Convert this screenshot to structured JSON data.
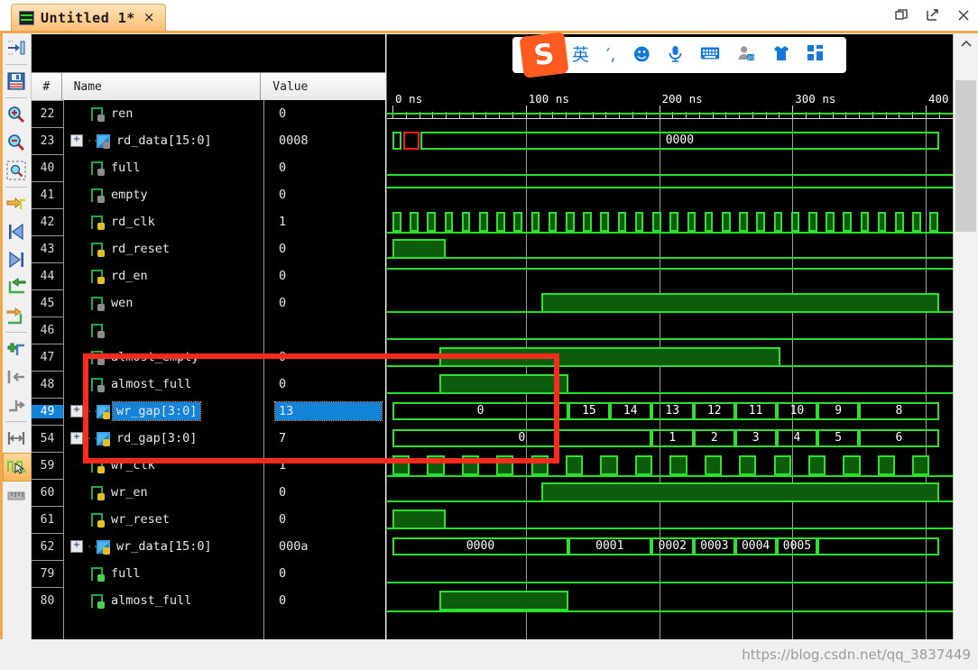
{
  "window": {
    "tab_title": "Untitled 1*",
    "tab_close_label": "×",
    "tab_icon": "waveform-icon",
    "controls": [
      {
        "name": "restore-window-button",
        "label": "❐"
      },
      {
        "name": "float-window-button",
        "label": "↗"
      },
      {
        "name": "close-window-button",
        "label": "✕"
      }
    ]
  },
  "toolbar": {
    "items": [
      {
        "name": "go-to-time-button",
        "icon": "arrow-into-bar-icon"
      },
      {
        "name": "save-waveform-button",
        "icon": "floppy-disk-icon"
      },
      {
        "name": "zoom-in-button",
        "icon": "magnifier-plus-icon"
      },
      {
        "name": "zoom-out-button",
        "icon": "magnifier-minus-icon"
      },
      {
        "name": "zoom-fit-button",
        "icon": "magnifier-fit-icon"
      },
      {
        "name": "snap-to-transition-button",
        "icon": "yellow-arrow-edge-icon"
      },
      {
        "name": "goto-start-button",
        "icon": "skip-to-start-icon"
      },
      {
        "name": "goto-end-button",
        "icon": "skip-to-end-icon"
      },
      {
        "name": "previous-transition-button",
        "icon": "green-arrow-left-icon"
      },
      {
        "name": "next-transition-button",
        "icon": "yellow-arrow-right-icon"
      },
      {
        "name": "add-marker-button",
        "icon": "add-marker-plus-icon"
      },
      {
        "name": "previous-marker-button",
        "icon": "marker-left-icon"
      },
      {
        "name": "next-marker-button",
        "icon": "marker-right-icon"
      },
      {
        "name": "measure-distance-button",
        "icon": "measure-span-icon"
      },
      {
        "name": "snap-to-edge-toggle",
        "icon": "snap-cursor-icon",
        "active": true
      },
      {
        "name": "show-ruler-button",
        "icon": "ruler-icon"
      }
    ]
  },
  "list": {
    "headers": {
      "num": "#",
      "name": "Name",
      "value": "Value"
    },
    "rows": [
      {
        "num": "22",
        "name": "ren",
        "value": "0",
        "icon": "signal-icon",
        "expandable": false,
        "selected": false
      },
      {
        "num": "23",
        "name": "rd_data[15:0]",
        "value": "0008",
        "icon": "bus-signal-icon",
        "expandable": true,
        "selected": false
      },
      {
        "num": "40",
        "name": "full",
        "value": "0",
        "icon": "signal-icon",
        "expandable": false,
        "selected": false
      },
      {
        "num": "41",
        "name": "empty",
        "value": "0",
        "icon": "signal-icon",
        "expandable": false,
        "selected": false
      },
      {
        "num": "42",
        "name": "rd_clk",
        "value": "1",
        "icon": "signal-lock-icon",
        "expandable": false,
        "selected": false
      },
      {
        "num": "43",
        "name": "rd_reset",
        "value": "0",
        "icon": "signal-lock-icon",
        "expandable": false,
        "selected": false
      },
      {
        "num": "44",
        "name": "rd_en",
        "value": "0",
        "icon": "signal-lock-icon",
        "expandable": false,
        "selected": false
      },
      {
        "num": "45",
        "name": "wen",
        "value": "0",
        "icon": "signal-icon",
        "expandable": false,
        "selected": false
      },
      {
        "num": "46",
        "name": "",
        "value": "",
        "icon": "signal-icon",
        "expandable": false,
        "selected": false
      },
      {
        "num": "47",
        "name": "almost_empty",
        "value": "0",
        "icon": "signal-icon",
        "expandable": false,
        "selected": false
      },
      {
        "num": "48",
        "name": "almost_full",
        "value": "0",
        "icon": "signal-icon",
        "expandable": false,
        "selected": false
      },
      {
        "num": "49",
        "name": "wr_gap[3:0]",
        "value": "13",
        "icon": "bus-lock-icon",
        "expandable": true,
        "selected": true
      },
      {
        "num": "54",
        "name": "rd_gap[3:0]",
        "value": "7",
        "icon": "bus-lock-icon",
        "expandable": true,
        "selected": false
      },
      {
        "num": "59",
        "name": "wr_clk",
        "value": "1",
        "icon": "signal-lock-icon",
        "expandable": false,
        "selected": false
      },
      {
        "num": "60",
        "name": "wr_en",
        "value": "0",
        "icon": "signal-lock-icon",
        "expandable": false,
        "selected": false
      },
      {
        "num": "61",
        "name": "wr_reset",
        "value": "0",
        "icon": "signal-lock-icon",
        "expandable": false,
        "selected": false
      },
      {
        "num": "62",
        "name": "wr_data[15:0]",
        "value": "000a",
        "icon": "bus-lock-icon",
        "expandable": true,
        "selected": false
      },
      {
        "num": "79",
        "name": "full",
        "value": "0",
        "icon": "signal-green-icon",
        "expandable": false,
        "selected": false
      },
      {
        "num": "80",
        "name": "almost_full",
        "value": "0",
        "icon": "signal-green-icon",
        "expandable": false,
        "selected": false
      }
    ]
  },
  "waveform": {
    "time_labels": [
      "0 ns",
      "100 ns",
      "200 ns",
      "300 ns",
      "400"
    ],
    "time_values": [
      0,
      100,
      200,
      300,
      400
    ],
    "bus_labels": {
      "rd_data": [
        "0000"
      ],
      "wr_gap": [
        "0",
        "15",
        "14",
        "13",
        "12",
        "11",
        "10",
        "9",
        "8"
      ],
      "rd_gap": [
        "0",
        "1",
        "2",
        "3",
        "4",
        "5",
        "6"
      ],
      "wr_data": [
        "0000",
        "0001",
        "0002",
        "0003",
        "0004",
        "0005"
      ]
    },
    "colors": {
      "signal": "#2ee02e",
      "fill": "#0c5c0c",
      "error": "#f02020",
      "grid": "#9d9d9d",
      "background": "#000000"
    },
    "annotation_box_color": "#fb2b1d"
  },
  "ime": {
    "logo": "S",
    "items": [
      {
        "name": "ime-language-mode",
        "label": "英"
      },
      {
        "name": "ime-punctuation-toggle",
        "label": "′,"
      },
      {
        "name": "ime-emoji-button",
        "label": "☻"
      },
      {
        "name": "ime-voice-input-button",
        "label": "♁"
      },
      {
        "name": "ime-soft-keyboard-button",
        "label": "⌸"
      },
      {
        "name": "ime-user-button",
        "label": "⛭"
      },
      {
        "name": "ime-skin-button",
        "label": "♟"
      },
      {
        "name": "ime-apps-button",
        "label": "∷"
      }
    ]
  },
  "watermark": {
    "text": "https://blog.csdn.net/qq_3837449"
  }
}
